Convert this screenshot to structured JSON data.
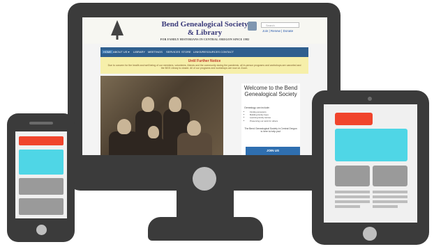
{
  "site": {
    "title_line1": "Bend Genealogical Society",
    "title_line2": "& Library",
    "tagline": "FOR FAMILY HISTORIANS IN CENTRAL OREGON SINCE 1982",
    "search_placeholder": "Search",
    "top_links": "Join | Renew | Donate"
  },
  "nav": {
    "items": [
      "HOME",
      "ABOUT US ▾",
      "LIBRARY",
      "MEETINGS",
      "SERVICES",
      "STORE",
      "LINKS/RESOURCES",
      "CONTACT"
    ]
  },
  "notice": {
    "heading": "Until Further Notice",
    "body": "Due to concern for the health and well being of our members, volunteers, friends and the community during the pandemic, all in-person programs and workshops are canceled and the BGS Library is closed. All of our programs and workshops are now on Zoom."
  },
  "welcome": {
    "title": "Welcome to the Bend Genealogical Society",
    "intro": "Genealogy can include:",
    "bullets": [
      "Finding ancestors",
      "Building family trees",
      "Learning family stories",
      "Preserving our work for others"
    ],
    "note": "The Bend Genealogical Society in Central Oregon is here to help you!",
    "join_label": "JOIN US"
  },
  "colors": {
    "device": "#3b3b3b",
    "nav": "#2f5f8e",
    "notice_bg": "#f6efaa",
    "accent_red": "#f0442c",
    "accent_cyan": "#4fd6e6"
  }
}
